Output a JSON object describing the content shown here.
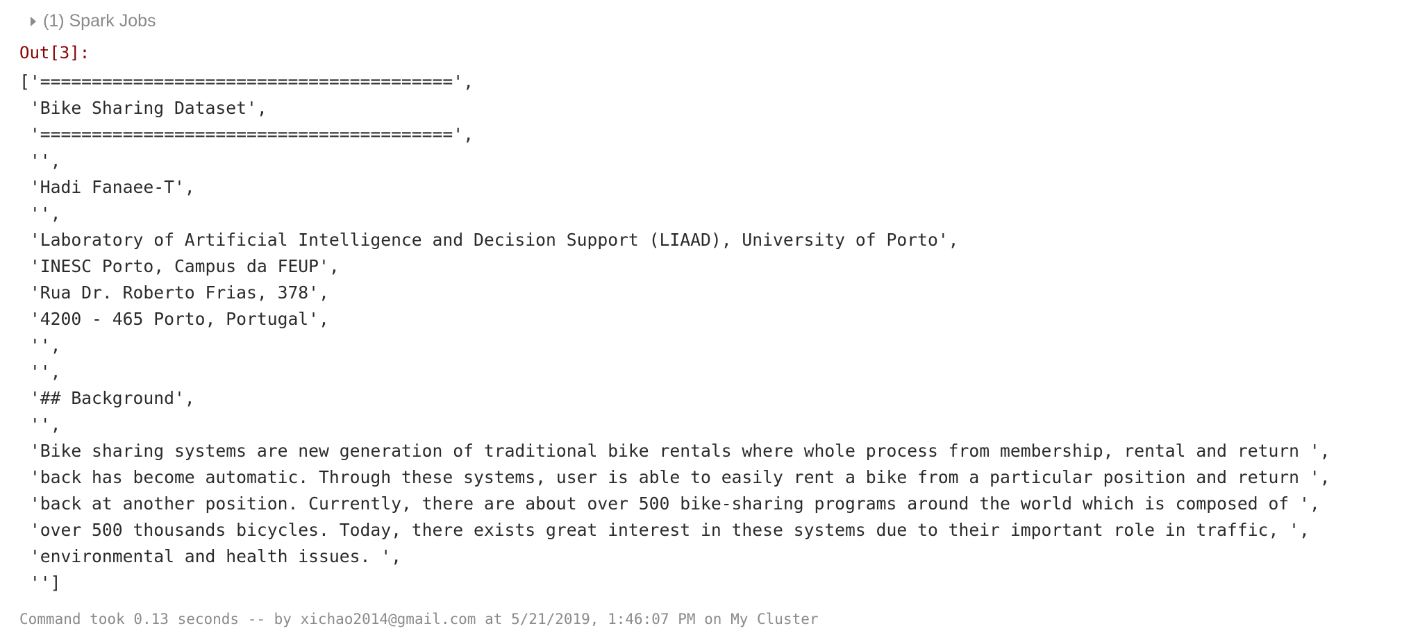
{
  "spark_jobs": {
    "label": "(1) Spark Jobs",
    "icon": "caret-right-icon"
  },
  "output": {
    "prompt": "Out[3]:",
    "lines": [
      "['========================================',",
      " 'Bike Sharing Dataset',",
      " '========================================',",
      " '',",
      " 'Hadi Fanaee-T',",
      " '',",
      " 'Laboratory of Artificial Intelligence and Decision Support (LIAAD), University of Porto',",
      " 'INESC Porto, Campus da FEUP',",
      " 'Rua Dr. Roberto Frias, 378',",
      " '4200 - 465 Porto, Portugal',",
      " '',",
      " '',",
      " '## Background',",
      " '',",
      " 'Bike sharing systems are new generation of traditional bike rentals where whole process from membership, rental and return ',",
      " 'back has become automatic. Through these systems, user is able to easily rent a bike from a particular position and return ',",
      " 'back at another position. Currently, there are about over 500 bike-sharing programs around the world which is composed of ',",
      " 'over 500 thousands bicycles. Today, there exists great interest in these systems due to their important role in traffic, ',",
      " 'environmental and health issues. ',",
      " '']"
    ]
  },
  "footer": {
    "text": "Command took 0.13 seconds -- by xichao2014@gmail.com at 5/21/2019, 1:46:07 PM on My Cluster"
  },
  "colors": {
    "prompt": "#8b0000",
    "text": "#2b2b2b",
    "muted": "#8a8a8a"
  }
}
